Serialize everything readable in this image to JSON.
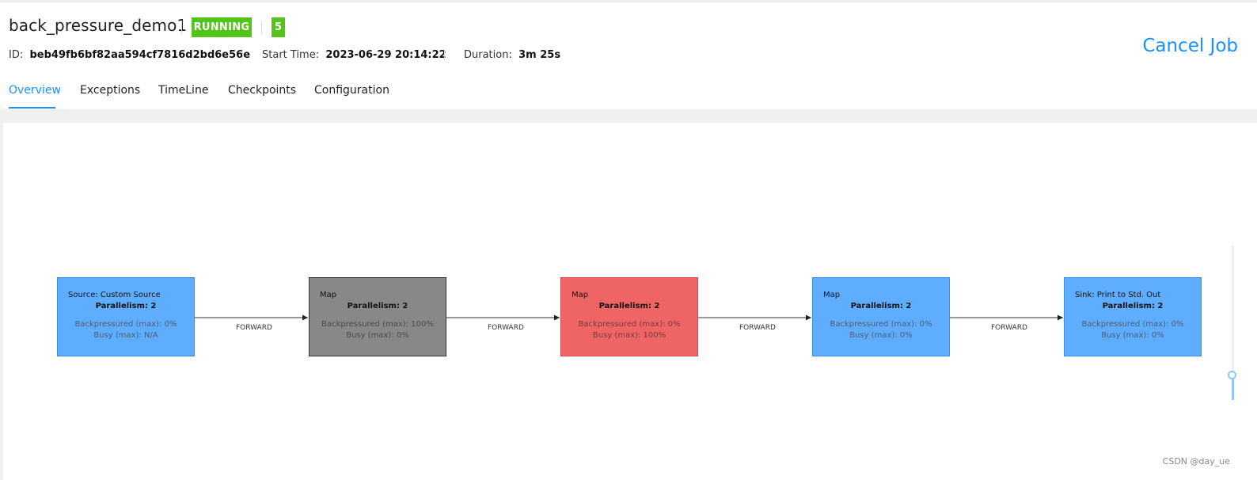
{
  "job": {
    "name": "back_pressure_demo1",
    "status": "RUNNING",
    "count": "5",
    "id_label": "ID:",
    "id_value": "beb49fb6bf82aa594cf7816d2bd6e56e",
    "start_label": "Start Time:",
    "start_value": "2023-06-29 20:14:22",
    "duration_label": "Duration:",
    "duration_value": "3m 25s",
    "cancel_label": "Cancel Job"
  },
  "tabs": [
    {
      "label": "Overview",
      "active": true
    },
    {
      "label": "Exceptions"
    },
    {
      "label": "TimeLine"
    },
    {
      "label": "Checkpoints"
    },
    {
      "label": "Configuration"
    }
  ],
  "graph": {
    "nodes": [
      {
        "title": "Source: Custom Source",
        "parallelism": "Parallelism: 2",
        "backpressured": "Backpressured (max): 0%",
        "busy": "Busy (max): N/A",
        "state": "normal"
      },
      {
        "title": "Map",
        "parallelism": "Parallelism: 2",
        "backpressured": "Backpressured (max): 100%",
        "busy": "Busy (max): 0%",
        "state": "backpressured"
      },
      {
        "title": "Map",
        "parallelism": "Parallelism: 2",
        "backpressured": "Backpressured (max): 0%",
        "busy": "Busy (max): 100%",
        "state": "busy"
      },
      {
        "title": "Map",
        "parallelism": "Parallelism: 2",
        "backpressured": "Backpressured (max): 0%",
        "busy": "Busy (max): 0%",
        "state": "normal"
      },
      {
        "title": "Sink: Print to Std. Out",
        "parallelism": "Parallelism: 2",
        "backpressured": "Backpressured (max): 0%",
        "busy": "Busy (max): 0%",
        "state": "normal"
      }
    ],
    "edges": [
      {
        "label": "FORWARD"
      },
      {
        "label": "FORWARD"
      },
      {
        "label": "FORWARD"
      },
      {
        "label": "FORWARD"
      }
    ]
  },
  "colors": {
    "accent": "#1890ff",
    "status_green": "#52c41a",
    "node_normal": "#5eadff",
    "node_backpressured": "#888888",
    "node_busy": "#ef6464"
  },
  "zoom_level": 0.15,
  "watermark": "CSDN @day_ue"
}
